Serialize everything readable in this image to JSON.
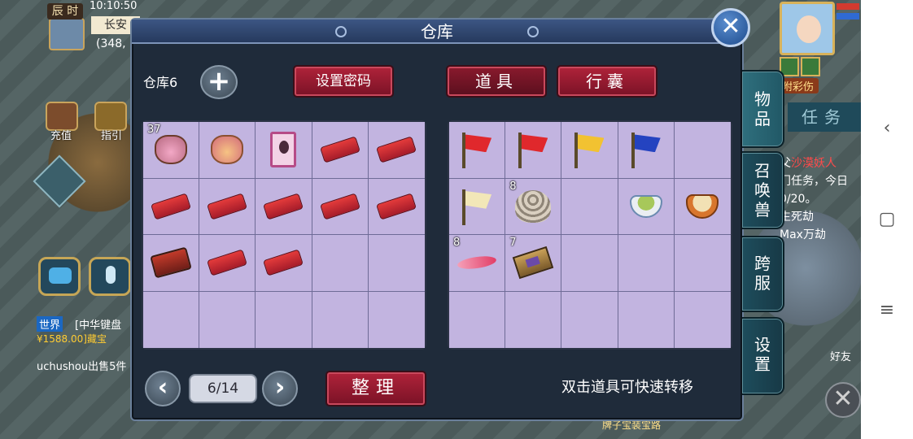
{
  "hud": {
    "time_label": "辰 时",
    "clock": "10:10:50",
    "city": "长安",
    "coords": "(348,",
    "recharge_label": "充值",
    "guide_label": "指引",
    "world_tag": "世界",
    "world_message": "[中华键盘",
    "world_price": "¥1588.00]藏宝",
    "user_message": "uchushou出售5件",
    "caiyi": "附彩伤",
    "task_tab": "任务",
    "quest_lines": [
      "父",
      "门任务，今日",
      "0/20。",
      "生死劫",
      "Max万劫"
    ],
    "quest_highlight": "沙漠妖人",
    "friends_label": "好友",
    "bottom_note": "牌子宝装宝路"
  },
  "panel": {
    "title": "仓库",
    "warehouse_label": "仓库6",
    "set_password_label": "设置密码",
    "items_tab_label": "道具",
    "bag_tab_label": "行囊",
    "page_indicator": "6/14",
    "sort_label": "整理",
    "hint": "双击道具可快速转移"
  },
  "left_grid": [
    {
      "icon": "pink-pouch-icon",
      "count": "37"
    },
    {
      "icon": "gift-bag-icon",
      "count": ""
    },
    {
      "icon": "summon-card-icon",
      "count": ""
    },
    {
      "icon": "red-carpet-icon",
      "count": ""
    },
    {
      "icon": "red-carpet-icon",
      "count": ""
    },
    {
      "icon": "red-carpet-icon",
      "count": ""
    },
    {
      "icon": "red-carpet-icon",
      "count": ""
    },
    {
      "icon": "red-carpet-icon",
      "count": ""
    },
    {
      "icon": "red-carpet-icon",
      "count": ""
    },
    {
      "icon": "red-carpet-icon",
      "count": ""
    },
    {
      "icon": "dark-carpet-icon",
      "count": ""
    },
    {
      "icon": "red-carpet-icon",
      "count": ""
    },
    {
      "icon": "red-carpet-icon",
      "count": ""
    },
    {
      "icon": "",
      "count": ""
    },
    {
      "icon": "",
      "count": ""
    },
    {
      "icon": "",
      "count": ""
    },
    {
      "icon": "",
      "count": ""
    },
    {
      "icon": "",
      "count": ""
    },
    {
      "icon": "",
      "count": ""
    },
    {
      "icon": "",
      "count": ""
    }
  ],
  "right_grid": [
    {
      "icon": "red-flag-icon",
      "count": ""
    },
    {
      "icon": "red-flag-icon",
      "count": ""
    },
    {
      "icon": "yellow-flag-icon",
      "count": ""
    },
    {
      "icon": "blue-flag-icon",
      "count": ""
    },
    {
      "icon": "",
      "count": ""
    },
    {
      "icon": "white-flag-icon",
      "count": ""
    },
    {
      "icon": "shell-icon",
      "count": "8"
    },
    {
      "icon": "",
      "count": ""
    },
    {
      "icon": "green-bowl-icon",
      "count": ""
    },
    {
      "icon": "noodle-bowl-icon",
      "count": ""
    },
    {
      "icon": "feather-icon",
      "count": "8"
    },
    {
      "icon": "book-icon",
      "count": "7"
    },
    {
      "icon": "",
      "count": ""
    },
    {
      "icon": "",
      "count": ""
    },
    {
      "icon": "",
      "count": ""
    },
    {
      "icon": "",
      "count": ""
    },
    {
      "icon": "",
      "count": ""
    },
    {
      "icon": "",
      "count": ""
    },
    {
      "icon": "",
      "count": ""
    },
    {
      "icon": "",
      "count": ""
    }
  ],
  "side_tabs": [
    {
      "label": "物品",
      "active": true
    },
    {
      "label": "召唤兽",
      "active": false
    },
    {
      "label": "跨服",
      "active": false
    },
    {
      "label": "设置",
      "active": false
    }
  ],
  "icons": {
    "add": "+",
    "prev": "‹",
    "next": "›",
    "close": "✕",
    "nav_back": "‹",
    "nav_home": "▢",
    "nav_menu": "≡"
  },
  "colors": {
    "accent_red": "#a61d33",
    "slot_bg": "#c2b4e0",
    "panel_bg": "#1f2b3a",
    "tab_bg": "#1e4d5c"
  }
}
